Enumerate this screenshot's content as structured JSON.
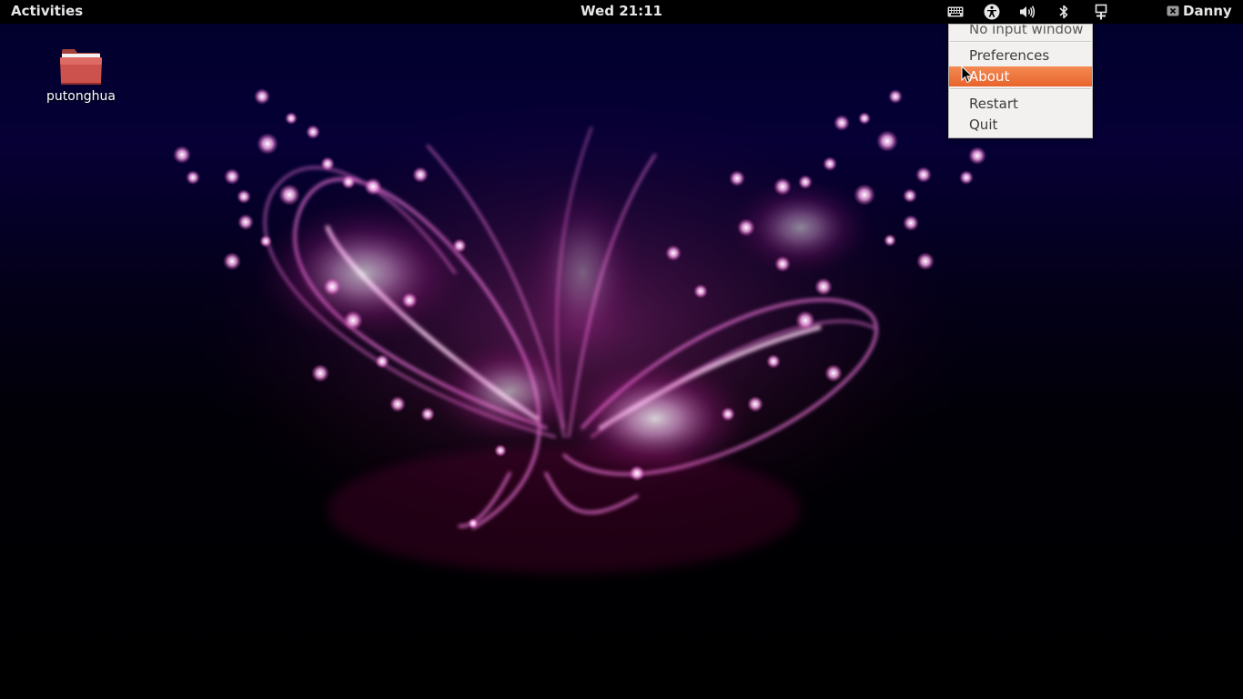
{
  "topbar": {
    "activities_label": "Activities",
    "clock": "Wed 21:11",
    "user_name": "Danny",
    "tray_icons": [
      "keyboard-icon",
      "accessibility-icon",
      "volume-icon",
      "bluetooth-icon",
      "network-icon"
    ]
  },
  "desktop": {
    "icons": [
      {
        "label": "putonghua",
        "icon": "folder-icon"
      }
    ],
    "wallpaper": "pink-magenta light-streak butterfly on dark navy-to-black gradient"
  },
  "menu": {
    "items": [
      {
        "label": "No input window",
        "enabled": false
      },
      {
        "label": "Preferences",
        "enabled": true
      },
      {
        "label": "About",
        "enabled": true,
        "highlighted": true
      },
      {
        "label": "Restart",
        "enabled": true
      },
      {
        "label": "Quit",
        "enabled": true
      }
    ]
  },
  "colors": {
    "topbar_bg": "#000000",
    "menu_bg": "#f2f1f0",
    "highlight": "#ee7440",
    "folder": "#c9504b",
    "glow": "#ff66e0"
  }
}
